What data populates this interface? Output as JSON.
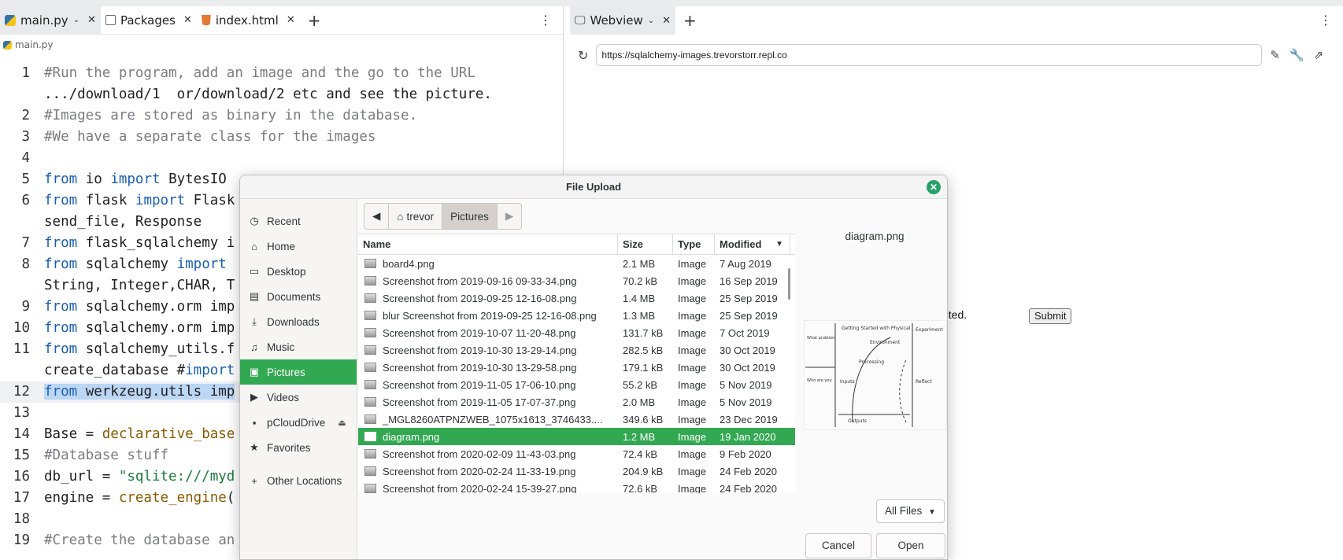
{
  "editor": {
    "tabs": [
      {
        "label": "main.py",
        "icon": "python-file-icon"
      },
      {
        "label": "Packages",
        "icon": "package-icon"
      },
      {
        "label": "index.html",
        "icon": "html-file-icon"
      }
    ],
    "breadcrumb": "main.py",
    "lines": [
      {
        "n": "1",
        "text": "#Run the program, add an image and the go to the URL"
      },
      {
        "n": "",
        "text": ".../download/1  or/download/2 etc and see the picture."
      },
      {
        "n": "2",
        "text": "#Images are stored as binary in the database."
      },
      {
        "n": "3",
        "text": "#We have a separate class for the images"
      },
      {
        "n": "4",
        "text": ""
      },
      {
        "n": "5",
        "text": "from io import BytesIO"
      },
      {
        "n": "6",
        "text": "from flask import Flask"
      },
      {
        "n": "",
        "text": "send_file, Response"
      },
      {
        "n": "7",
        "text": "from flask_sqlalchemy i"
      },
      {
        "n": "8",
        "text": "from sqlalchemy import"
      },
      {
        "n": "",
        "text": "String, Integer,CHAR, T"
      },
      {
        "n": "9",
        "text": "from sqlalchemy.orm imp"
      },
      {
        "n": "10",
        "text": "from sqlalchemy.orm imp"
      },
      {
        "n": "11",
        "text": "from sqlalchemy_utils.f"
      },
      {
        "n": "",
        "text": "create_database #import"
      },
      {
        "n": "12",
        "text": "from werkzeug.utils imp"
      },
      {
        "n": "13",
        "text": ""
      },
      {
        "n": "14",
        "text": "Base = declarative_base"
      },
      {
        "n": "15",
        "text": "#Database stuff"
      },
      {
        "n": "16",
        "text": "db_url = \"sqlite:///myd"
      },
      {
        "n": "17",
        "text": "engine = create_engine("
      },
      {
        "n": "18",
        "text": ""
      },
      {
        "n": "19",
        "text": "#Create the database an"
      }
    ]
  },
  "webview": {
    "tab_label": "Webview",
    "url": "https://sqlalchemy-images.trevorstorr.repl.co",
    "page_text": "ected.",
    "submit_label": "Submit"
  },
  "dialog": {
    "title": "File Upload",
    "places": [
      {
        "label": "Recent",
        "icon": "clock-icon"
      },
      {
        "label": "Home",
        "icon": "home-icon"
      },
      {
        "label": "Desktop",
        "icon": "desktop-icon"
      },
      {
        "label": "Documents",
        "icon": "document-icon"
      },
      {
        "label": "Downloads",
        "icon": "download-icon"
      },
      {
        "label": "Music",
        "icon": "music-icon"
      },
      {
        "label": "Pictures",
        "icon": "picture-icon"
      },
      {
        "label": "Videos",
        "icon": "video-icon"
      },
      {
        "label": "pCloudDrive",
        "icon": "drive-icon"
      },
      {
        "label": "Favorites",
        "icon": "star-icon"
      },
      {
        "label": "Other Locations",
        "icon": "plus-icon"
      }
    ],
    "path": [
      "trevor",
      "Pictures"
    ],
    "columns": {
      "name": "Name",
      "size": "Size",
      "type": "Type",
      "modified": "Modified"
    },
    "files": [
      {
        "name": "board4.png",
        "size": "2.1 MB",
        "type": "Image",
        "modified": "7 Aug 2019"
      },
      {
        "name": "Screenshot from 2019-09-16 09-33-34.png",
        "size": "70.2 kB",
        "type": "Image",
        "modified": "16 Sep 2019"
      },
      {
        "name": "Screenshot from 2019-09-25 12-16-08.png",
        "size": "1.4 MB",
        "type": "Image",
        "modified": "25 Sep 2019"
      },
      {
        "name": "blur Screenshot from 2019-09-25 12-16-08.png",
        "size": "1.3 MB",
        "type": "Image",
        "modified": "25 Sep 2019"
      },
      {
        "name": "Screenshot from 2019-10-07 11-20-48.png",
        "size": "131.7 kB",
        "type": "Image",
        "modified": "7 Oct 2019"
      },
      {
        "name": "Screenshot from 2019-10-30 13-29-14.png",
        "size": "282.5 kB",
        "type": "Image",
        "modified": "30 Oct 2019"
      },
      {
        "name": "Screenshot from 2019-10-30 13-29-58.png",
        "size": "179.1 kB",
        "type": "Image",
        "modified": "30 Oct 2019"
      },
      {
        "name": "Screenshot from 2019-11-05 17-06-10.png",
        "size": "55.2 kB",
        "type": "Image",
        "modified": "5 Nov 2019"
      },
      {
        "name": "Screenshot from 2019-11-05 17-07-37.png",
        "size": "2.0 MB",
        "type": "Image",
        "modified": "5 Nov 2019"
      },
      {
        "name": "_MGL8260ATPNZWEB_1075x1613_3746433....",
        "size": "349.6 kB",
        "type": "Image",
        "modified": "23 Dec 2019"
      },
      {
        "name": "diagram.png",
        "size": "1.2 MB",
        "type": "Image",
        "modified": "19 Jan 2020",
        "selected": true
      },
      {
        "name": "Screenshot from 2020-02-09 11-43-03.png",
        "size": "72.4 kB",
        "type": "Image",
        "modified": "9 Feb 2020"
      },
      {
        "name": "Screenshot from 2020-02-24 11-33-19.png",
        "size": "204.9 kB",
        "type": "Image",
        "modified": "24 Feb 2020"
      },
      {
        "name": "Screenshot from 2020-02-24 15-39-27.png",
        "size": "72.6 kB",
        "type": "Image",
        "modified": "24 Feb 2020"
      }
    ],
    "preview_name": "diagram.png",
    "filter": "All Files",
    "cancel_label": "Cancel",
    "open_label": "Open"
  }
}
